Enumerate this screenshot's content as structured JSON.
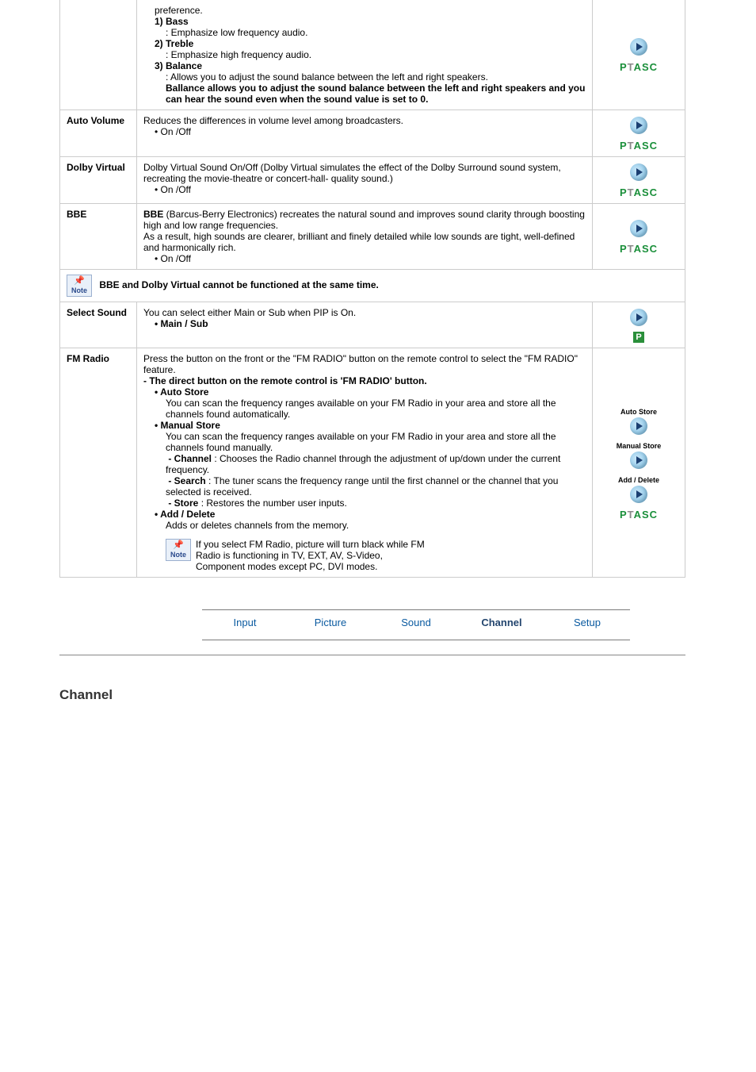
{
  "topFragment": {
    "preference": "preference.",
    "bassTitle": "1) Bass",
    "bassDesc": ": Emphasize low frequency audio.",
    "trebleTitle": "2) Treble",
    "trebleDesc": ": Emphasize high frequency audio.",
    "balanceTitle": "3) Balance",
    "balanceDesc": ": Allows you to adjust the sound balance between the left and right speakers.",
    "balanceNote": "Ballance allows you to adjust the sound balance between the left and right speakers and you can hear the sound even when the sound value is set to 0."
  },
  "rows": {
    "autoVolume": {
      "label": "Auto Volume",
      "text": "Reduces the differences in volume level among broadcasters.",
      "bullet": "• On /Off"
    },
    "dolby": {
      "label": "Dolby Virtual",
      "text": "Dolby Virtual Sound On/Off (Dolby Virtual simulates the effect of the Dolby Surround sound system, recreating the movie-theatre or concert-hall- quality sound.)",
      "bullet": "• On /Off"
    },
    "bbe": {
      "label": "BBE",
      "boldLead": "BBE",
      "text1": " (Barcus-Berry Electronics) recreates the natural sound and improves sound clarity through boosting high and low range frequencies.",
      "text2": "As a result, high sounds are clearer, brilliant and finely detailed while low sounds are tight, well-defined and harmonically rich.",
      "bullet": "• On /Off"
    },
    "noteRow": {
      "text": "BBE and Dolby Virtual cannot be functioned at the same time."
    },
    "selectSound": {
      "label": "Select Sound",
      "text": "You can select either Main or Sub when PIP is On.",
      "bullet": "• Main / Sub"
    },
    "fmRadio": {
      "label": "FM Radio",
      "intro": "Press the button on the front or the \"FM RADIO\" button on the remote control to select the \"FM RADIO\" feature.",
      "introBold": "- The direct button on the remote control is 'FM RADIO' button.",
      "autoStoreTitle": "• Auto Store",
      "autoStoreText": "You can scan the frequency ranges available on your FM Radio in your area and store all the channels found automatically.",
      "manualStoreTitle": "• Manual Store",
      "manualStoreText": "You can scan the frequency ranges available on your FM Radio in your area and store all the channels found manually.",
      "channelLine": " : Chooses the Radio channel through the adjustment of up/down under the current frequency.",
      "channelBold": "- Channel",
      "searchBold": "- Search",
      "searchLine": " : The tuner scans the frequency range until the first channel or the channel that you selected is received.",
      "storeBold": "- Store",
      "storeLine": " : Restores the number user inputs.",
      "addDeleteTitle": "• Add / Delete",
      "addDeleteText": "Adds or deletes channels from the memory.",
      "noteText": "If you select FM Radio, picture will turn black while FM Radio is functioning in TV, EXT, AV, S-Video, Component modes except PC, DVI modes.",
      "iconLabels": {
        "auto": "Auto Store",
        "manual": "Manual Store",
        "addDel": "Add / Delete"
      }
    }
  },
  "noteBadge": "Note",
  "ptasc": {
    "p": "P",
    "t": "T",
    "a": "A",
    "s": "S",
    "c": "C"
  },
  "nav": {
    "input": "Input",
    "picture": "Picture",
    "sound": "Sound",
    "channel": "Channel",
    "setup": "Setup"
  },
  "sectionTitle": "Channel"
}
